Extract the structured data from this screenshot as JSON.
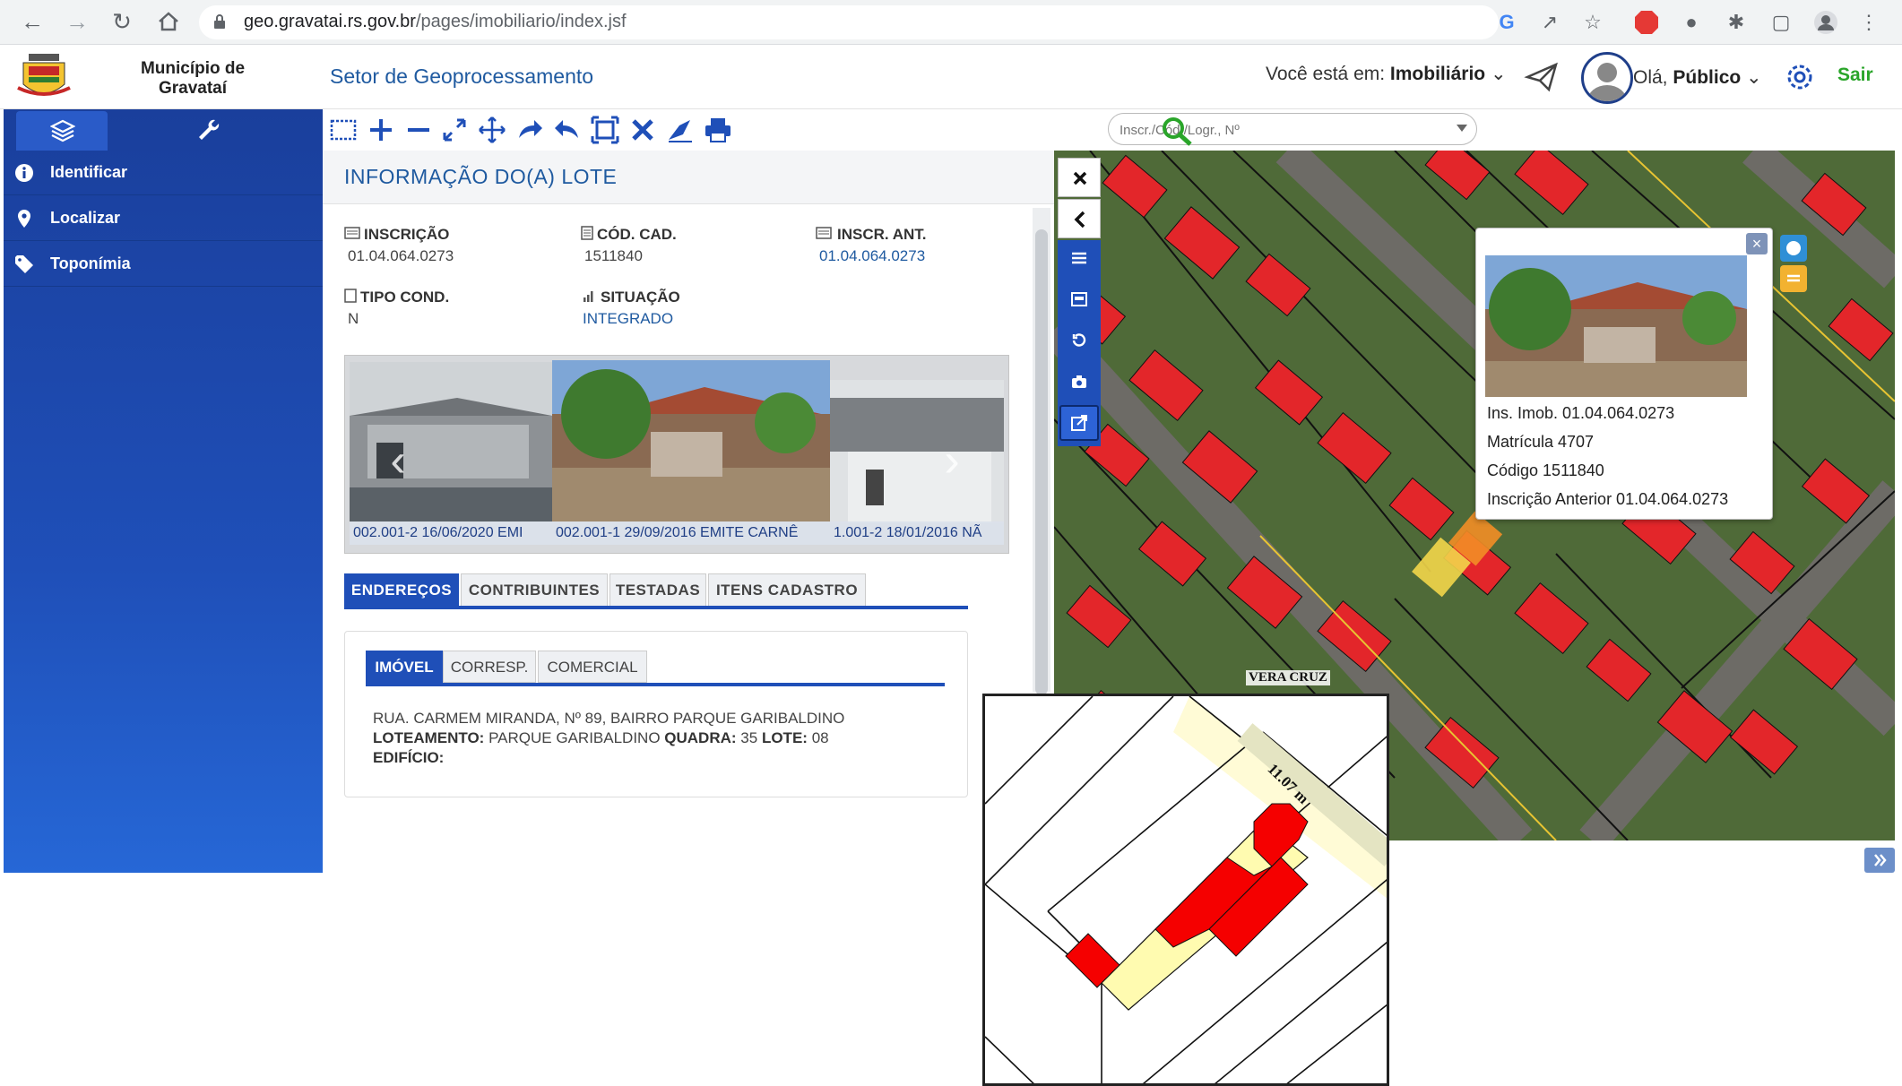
{
  "browser": {
    "url_host": "geo.gravatai.rs.gov.br",
    "url_path": "/pages/imobiliario/index.jsf"
  },
  "header": {
    "municipality_line1": "Município de",
    "municipality_line2": "Gravataí",
    "sector": "Setor de Geoprocessamento",
    "location_prefix": "Você está em:",
    "location_value": "Imobiliário",
    "greeting_prefix": "Olá,",
    "greeting_user": "Público",
    "logout": "Sair"
  },
  "sidebar": {
    "items": [
      {
        "label": "Identificar",
        "icon": "info-icon"
      },
      {
        "label": "Localizar",
        "icon": "map-pin-icon"
      },
      {
        "label": "Toponímia",
        "icon": "tag-icon"
      }
    ]
  },
  "toolbar": {
    "search_placeholder": "Inscr./Cód./Logr., Nº"
  },
  "panel": {
    "title": "INFORMAÇÃO DO(A) LOTE",
    "fields": {
      "inscricao_label": "INSCRIÇÃO",
      "inscricao_value": "01.04.064.0273",
      "cod_cad_label": "CÓD. CAD.",
      "cod_cad_value": "1511840",
      "inscr_ant_label": "INSCR. ANT.",
      "inscr_ant_value": "01.04.064.0273",
      "tipo_cond_label": "TIPO COND.",
      "tipo_cond_value": "N",
      "situacao_label": "SITUAÇÃO",
      "situacao_value": "INTEGRADO"
    },
    "carousel_captions": [
      "002.001-2 16/06/2020 EMI",
      "002.001-1 29/09/2016 EMITE CARNÊ",
      "1.001-2 18/01/2016 NÃ"
    ],
    "tabs": [
      "ENDEREÇOS",
      "CONTRIBUINTES",
      "TESTADAS",
      "ITENS CADASTRO"
    ],
    "subtabs": [
      "IMÓVEL",
      "CORRESP.",
      "COMERCIAL"
    ],
    "address_line": "RUA. CARMEM MIRANDA, Nº 89, BAIRRO PARQUE GARIBALDINO",
    "loteamento_label": "LOTEAMENTO:",
    "loteamento_value": "PARQUE GARIBALDINO",
    "quadra_label": "QUADRA:",
    "quadra_value": "35",
    "lote_label": "LOTE:",
    "lote_value": "08",
    "edificio_label": "EDIFÍCIO:"
  },
  "map": {
    "street_label": "VERA CRUZ",
    "popup": {
      "ins_imob": "Ins. Imob. 01.04.064.0273",
      "matricula": "Matrícula 4707",
      "codigo": "Código 1511840",
      "inscricao_anterior": "Inscrição Anterior 01.04.064.0273"
    },
    "inset_measure": "11.07 m"
  }
}
